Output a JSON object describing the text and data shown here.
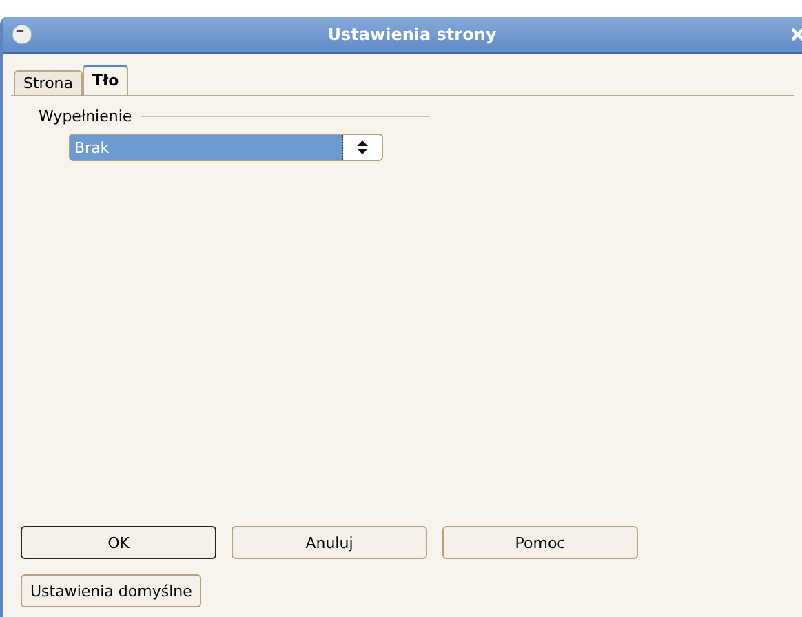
{
  "window": {
    "title": "Ustawienia strony"
  },
  "tabs": [
    {
      "label": "Strona",
      "selected": false
    },
    {
      "label": "Tło",
      "selected": true
    }
  ],
  "fill_section": {
    "label": "Wypełnienie",
    "select": {
      "value": "Brak",
      "focused": true
    }
  },
  "buttons": [
    {
      "label": "OK",
      "default": true
    },
    {
      "label": "Anuluj",
      "default": false
    },
    {
      "label": "Pomoc",
      "default": false
    }
  ],
  "extra_button": {
    "label": "Ustawienia domyślne"
  }
}
